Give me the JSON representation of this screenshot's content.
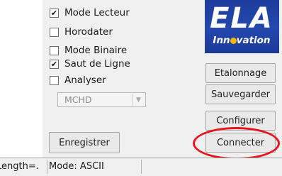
{
  "options": {
    "mode_lecteur": {
      "label": "Mode Lecteur",
      "checked": true
    },
    "horodater": {
      "label": "Horodater",
      "checked": false
    },
    "mode_binaire": {
      "label": "Mode Binaire",
      "checked": false
    },
    "saut_de_ligne": {
      "label": "Saut de Ligne",
      "checked": true
    },
    "analyser": {
      "label": "Analyser",
      "checked": false
    }
  },
  "analyser_select": {
    "value": "MCHD"
  },
  "buttons": {
    "etalonnage": "Etalonnage",
    "sauvegarder": "Sauvegarder",
    "configurer": "Configurer",
    "connecter": "Connecter",
    "enregistrer": "Enregistrer"
  },
  "logo": {
    "brand": "ELA",
    "tag_before": "Inn",
    "tag_after": "vation"
  },
  "status_bar": {
    "length": "Length=.",
    "mode": "Mode: ASCII"
  },
  "icons": {
    "check": "check-mark",
    "dropdown": "chevron-down-icon",
    "logo_dot": "ela-logo-dot"
  },
  "colors": {
    "logo_blue": "#2448ae",
    "highlight_red": "#e8151d",
    "logo_dot": "#f2b800"
  }
}
